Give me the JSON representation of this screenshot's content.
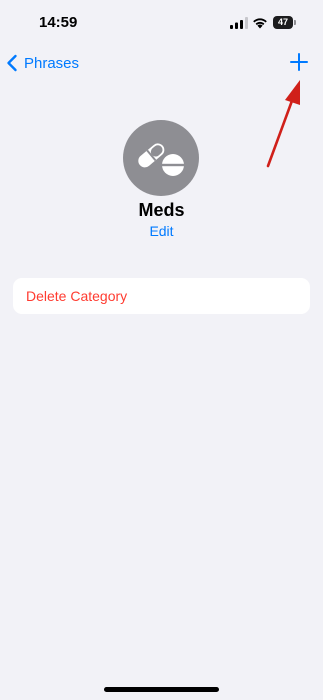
{
  "status_bar": {
    "time": "14:59",
    "battery_level": "47"
  },
  "nav": {
    "back_label": "Phrases",
    "add_icon": "plus-icon"
  },
  "header": {
    "icon": "pills-icon",
    "title": "Meds",
    "edit_label": "Edit"
  },
  "list": {
    "delete_label": "Delete Category"
  },
  "colors": {
    "accent": "#007aff",
    "destructive": "#ff3b30",
    "background": "#f2f2f7",
    "icon_circle": "#8e8e93",
    "annotation_arrow": "#d0201a"
  }
}
